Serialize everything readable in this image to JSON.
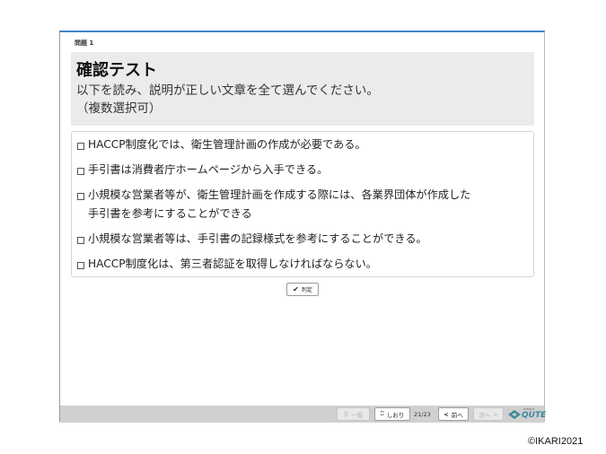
{
  "question_label": "問題 1",
  "title": "確認テスト",
  "instruction_line1": "以下を読み、説明が正しい文章を全て選んでください。",
  "instruction_line2": "（複数選択可）",
  "choices": [
    {
      "text_line1": "HACCP制度化では、衛生管理計画の作成が必要である。",
      "text_line2": "",
      "checked": false
    },
    {
      "text_line1": "手引書は消費者庁ホームページから入手できる。",
      "text_line2": "",
      "checked": false
    },
    {
      "text_line1": "小規模な営業者等が、衛生管理計画を作成する際には、各業界団体が作成した",
      "text_line2": "手引書を参考にすることができる",
      "checked": false
    },
    {
      "text_line1": "小規模な営業者等は、手引書の記録様式を参考にすることができる。",
      "text_line2": "",
      "checked": false
    },
    {
      "text_line1": "HACCP制度化は、第三者認証を取得しなければならない。",
      "text_line2": "",
      "checked": false
    }
  ],
  "judge_button": "判定",
  "footer": {
    "list_button": "一覧",
    "bookmark_button": "しおり",
    "page_indicator": "21/23",
    "prev_button": "前へ",
    "next_button": "次へ",
    "logo_small": "smart",
    "logo_main": "QUTE"
  },
  "copyright": "©IKARI2021",
  "colors": {
    "accent": "#3a86c8",
    "header_bg": "#ebebeb",
    "footer_bg": "#d0d0d0"
  }
}
